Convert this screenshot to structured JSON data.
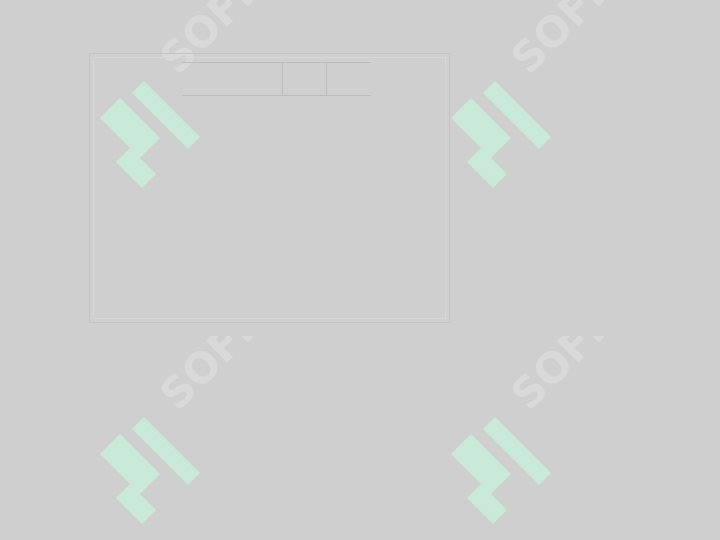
{
  "watermark": {
    "brand_text": "SOFF",
    "logo_color": "#c9ead8",
    "text_color": "#d9d9d9"
  },
  "panel": {
    "strip": {
      "cell_a_label": "",
      "cell_b_label": ""
    }
  },
  "colors": {
    "background": "#cfcfcf",
    "border": "#bcbcbc",
    "panel_border": "#c4c4c4"
  }
}
